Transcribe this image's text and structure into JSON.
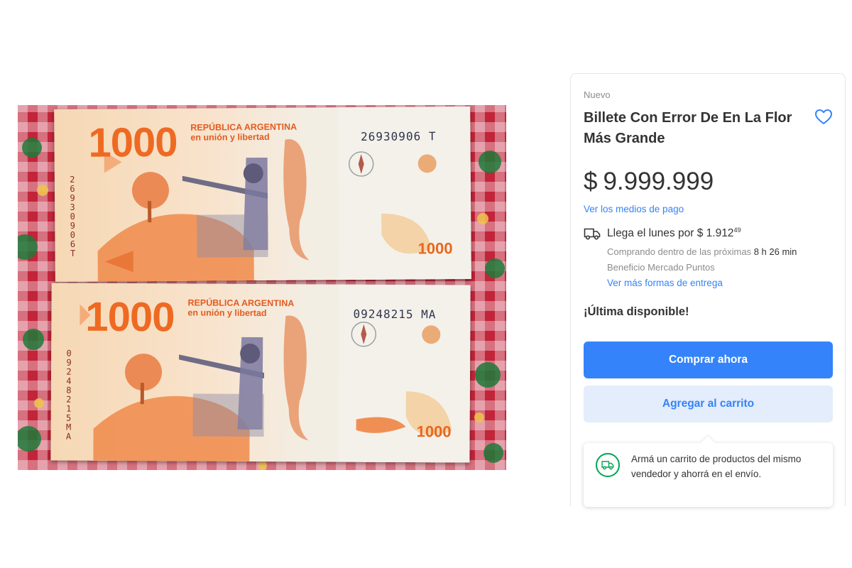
{
  "photo": {
    "alt_hidden": "",
    "top_bill": {
      "denomination": "1000",
      "heading_line1": "REPÚBLICA ARGENTINA",
      "heading_line2": "en unión y libertad",
      "serial": "26930906 T",
      "serial_vertical": "26930906T",
      "small_denomination": "1000"
    },
    "bottom_bill": {
      "denomination": "1000",
      "heading_line1": "REPÚBLICA ARGENTINA",
      "heading_line2": "en unión y libertad",
      "serial": "09248215 MA",
      "serial_vertical": "09248215MA",
      "small_denomination": "1000"
    }
  },
  "product": {
    "condition": "Nuevo",
    "title": "Billete Con Error De En La Flor Más Grande",
    "favorite_icon": "heart-outline-icon",
    "price_currency": "$",
    "price_amount": "9.999.999",
    "payment_link": "Ver los medios de pago"
  },
  "shipping": {
    "icon": "truck-icon",
    "arrival_label": "Llega el lunes",
    "arrival_connector": "por",
    "cost_currency": "$",
    "cost_main": "1.912",
    "cost_cents": "49",
    "buy_within_label": "Comprando dentro de las próximas",
    "buy_within_time": "8 h 26 min",
    "benefit": "Beneficio Mercado Puntos",
    "more_options_link": "Ver más formas de entrega"
  },
  "stock": "¡Última disponible!",
  "actions": {
    "buy_now": "Comprar ahora",
    "add_to_cart": "Agregar al carrito"
  },
  "cart_tip": {
    "icon": "truck-icon",
    "text": "Armá un carrito de productos del mismo vendedor y ahorrá en el envío."
  },
  "colors": {
    "accent": "#3483fa",
    "accent_light": "#e3edfb",
    "green": "#00a650",
    "bill_orange": "#ee6a22"
  }
}
